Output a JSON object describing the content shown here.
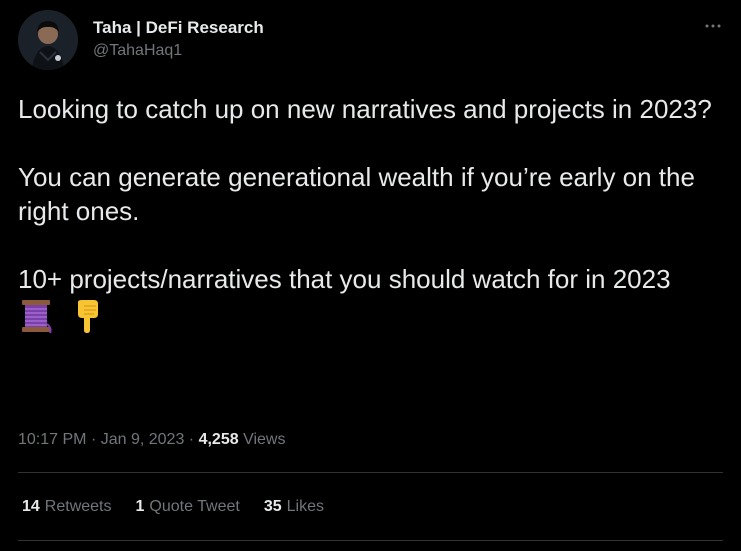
{
  "author": {
    "display_name": "Taha | DeFi Research",
    "handle": "@TahaHaq1"
  },
  "tweet": {
    "paragraphs": [
      "Looking to catch up on new narratives and projects in 2023?",
      "You can generate generational wealth if you’re early on the right ones.",
      "10+ projects/narratives that you should watch for in 2023"
    ],
    "emojis": [
      "thread-spool-icon",
      "pointing-down-icon"
    ]
  },
  "meta": {
    "time": "10:17 PM",
    "separator": "·",
    "date": "Jan 9, 2023",
    "views_count": "4,258",
    "views_label": "Views"
  },
  "stats": {
    "retweets_count": "14",
    "retweets_label": "Retweets",
    "quotes_count": "1",
    "quotes_label": "Quote Tweet",
    "likes_count": "35",
    "likes_label": "Likes"
  },
  "colors": {
    "background": "#000000",
    "text_primary": "#e7e9ea",
    "text_secondary": "#71767b",
    "divider": "#2f3336"
  }
}
